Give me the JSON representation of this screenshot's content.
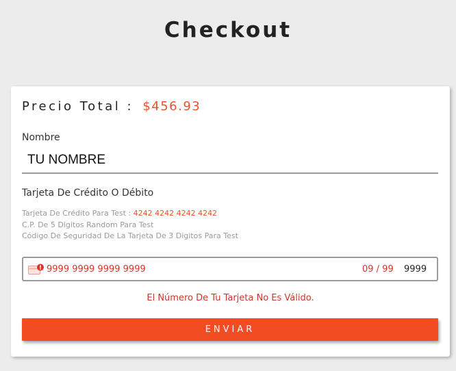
{
  "header": {
    "title": "Checkout"
  },
  "checkout": {
    "total_label": "Precio Total :",
    "total_amount": "$456.93",
    "name": {
      "label": "Nombre",
      "value": "TU NOMBRE"
    },
    "card": {
      "label": "Tarjeta De Crédito O Débito",
      "help": {
        "test_card_label": "Tarjeta De Crédito Para Test :",
        "test_card_number": "4242 4242 4242 4242",
        "zip_hint": "C.P. De 5 Digitos Random Para Test",
        "cvc_hint": "Código De Seguridad De La Tarjeta De 3 Digitos Para Test"
      },
      "number_value": "9999 9999 9999 9999",
      "expiry_value": "09 / 99",
      "cvc_value": "9999",
      "icon": "card-error-icon",
      "error_message": "El Número De Tu Tarjeta No Es Válido."
    },
    "submit_label": "ENVIAR"
  },
  "colors": {
    "accent": "#f04d23",
    "price": "#e8542b",
    "error": "#c8382d",
    "background": "#ececec"
  }
}
